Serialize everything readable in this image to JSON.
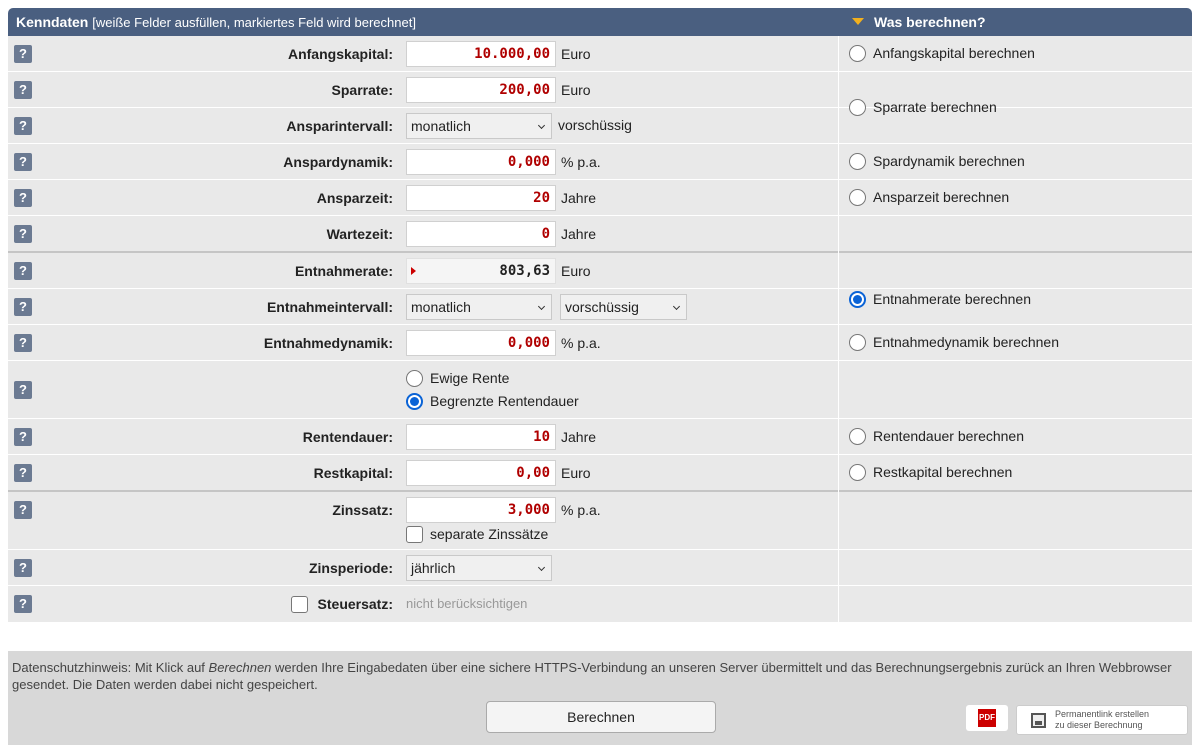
{
  "header": {
    "title": "Kenndaten",
    "subtitle": "[weiße Felder ausfüllen, markiertes Feld wird berechnet]",
    "calc_title": "Was berechnen?"
  },
  "help_label": "?",
  "fields": {
    "anfangskapital": {
      "label": "Anfangskapital:",
      "value": "10.000,00",
      "unit": "Euro"
    },
    "sparrate": {
      "label": "Sparrate:",
      "value": "200,00",
      "unit": "Euro"
    },
    "ansparintervall": {
      "label": "Ansparintervall:",
      "selected": "monatlich",
      "suffix": "vorschüssig"
    },
    "anspardynamik": {
      "label": "Anspardynamik:",
      "value": "0,000",
      "unit": "% p.a."
    },
    "ansparzeit": {
      "label": "Ansparzeit:",
      "value": "20",
      "unit": "Jahre"
    },
    "wartezeit": {
      "label": "Wartezeit:",
      "value": "0",
      "unit": "Jahre"
    },
    "entnahmerate": {
      "label": "Entnahmerate:",
      "value": "803,63",
      "unit": "Euro"
    },
    "entnahmeintervall": {
      "label": "Entnahmeintervall:",
      "selected": "monatlich",
      "timing": "vorschüssig"
    },
    "entnahmedynamik": {
      "label": "Entnahmedynamik:",
      "value": "0,000",
      "unit": "% p.a."
    },
    "rentenart": {
      "option1": "Ewige Rente",
      "option2": "Begrenzte Rentendauer"
    },
    "rentendauer": {
      "label": "Rentendauer:",
      "value": "10",
      "unit": "Jahre"
    },
    "restkapital": {
      "label": "Restkapital:",
      "value": "0,00",
      "unit": "Euro"
    },
    "zinssatz": {
      "label": "Zinssatz:",
      "value": "3,000",
      "unit": "% p.a.",
      "separate": "separate Zinssätze"
    },
    "zinsperiode": {
      "label": "Zinsperiode:",
      "selected": "jährlich"
    },
    "steuersatz": {
      "label": "Steuersatz:",
      "value": "nicht berücksichtigen"
    }
  },
  "calc_options": {
    "anfangskapital": "Anfangskapital berechnen",
    "sparrate": "Sparrate berechnen",
    "spardynamik": "Spardynamik berechnen",
    "ansparzeit": "Ansparzeit berechnen",
    "entnahmerate": "Entnahmerate berechnen",
    "entnahmedynamik": "Entnahmedynamik berechnen",
    "rentendauer": "Rentendauer berechnen",
    "restkapital": "Restkapital berechnen"
  },
  "footer": {
    "note_pre": "Datenschutzhinweis: Mit Klick auf ",
    "note_em": "Berechnen",
    "note_post": " werden Ihre Eingabedaten über eine sichere HTTPS-Verbindung an unseren Server übermittelt und das Berechnungsergebnis zurück an Ihren Webbrowser gesendet. Die Daten werden dabei nicht gespeichert.",
    "calc_button": "Berechnen",
    "pdf_icon": "PDF",
    "perm_line1": "Permanentlink erstellen",
    "perm_line2": "zu dieser Berechnung"
  },
  "icons": {
    "help": "help-icon",
    "pdf": "pdf-icon",
    "save": "save-icon",
    "dropdown": "triangle-down-icon"
  },
  "colors": {
    "header_bg": "#4a5f80",
    "input_value": "#b00000",
    "radio_selected": "#0a63d6",
    "row_bg": "#e9e9e9"
  }
}
